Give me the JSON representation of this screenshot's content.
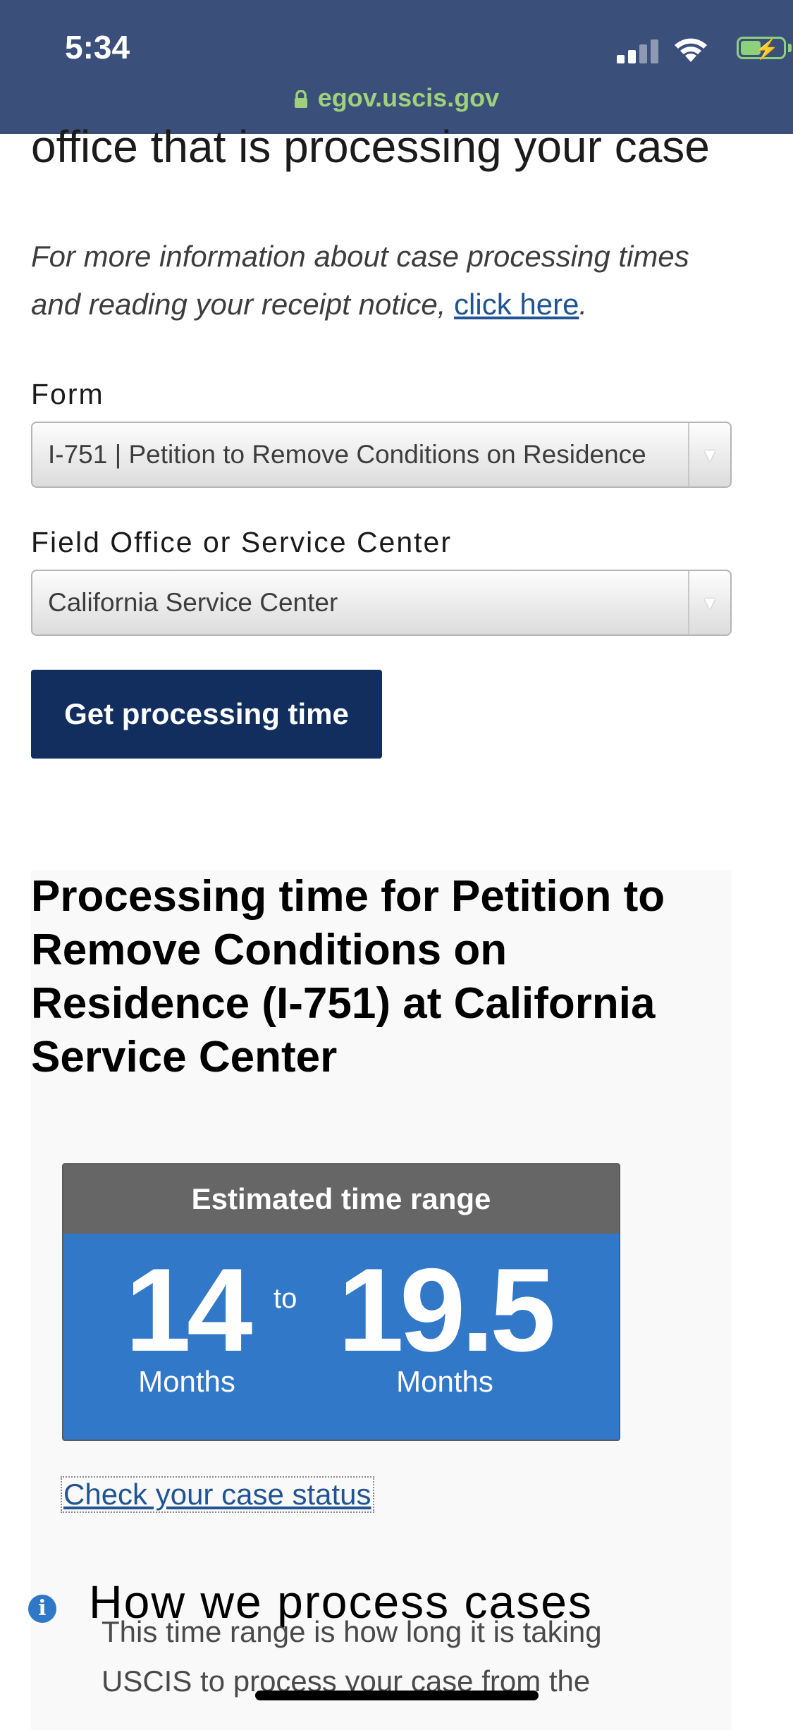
{
  "status_bar": {
    "time": "5:34"
  },
  "browser": {
    "url": "egov.uscis.gov"
  },
  "page": {
    "heading_cut": "office that is processing your case",
    "info_text": "For more information about case processing times and reading your receipt notice, ",
    "info_link": "click here",
    "info_end": "."
  },
  "form": {
    "form_label": "Form",
    "form_value": "I-751 | Petition to Remove Conditions on Residence",
    "office_label": "Field Office or Service Center",
    "office_value": "California Service Center",
    "submit_label": "Get processing time"
  },
  "result": {
    "title": "Processing time for Petition to Remove Conditions on Residence (I-751) at California Service Center",
    "range_header": "Estimated time range",
    "min_value": "14",
    "min_unit": "Months",
    "to": "to",
    "max_value": "19.5",
    "max_unit": "Months",
    "case_status_link": "Check your case status"
  },
  "how": {
    "title": "How we process cases",
    "body": "This time range is how long it is taking USCIS to process your case from the"
  },
  "colors": {
    "header_bg": "#3a4f7a",
    "url_green": "#9fd07c",
    "button_navy": "#112e5f",
    "range_blue": "#3278c8",
    "range_header_gray": "#666666",
    "link_blue": "#205493"
  }
}
